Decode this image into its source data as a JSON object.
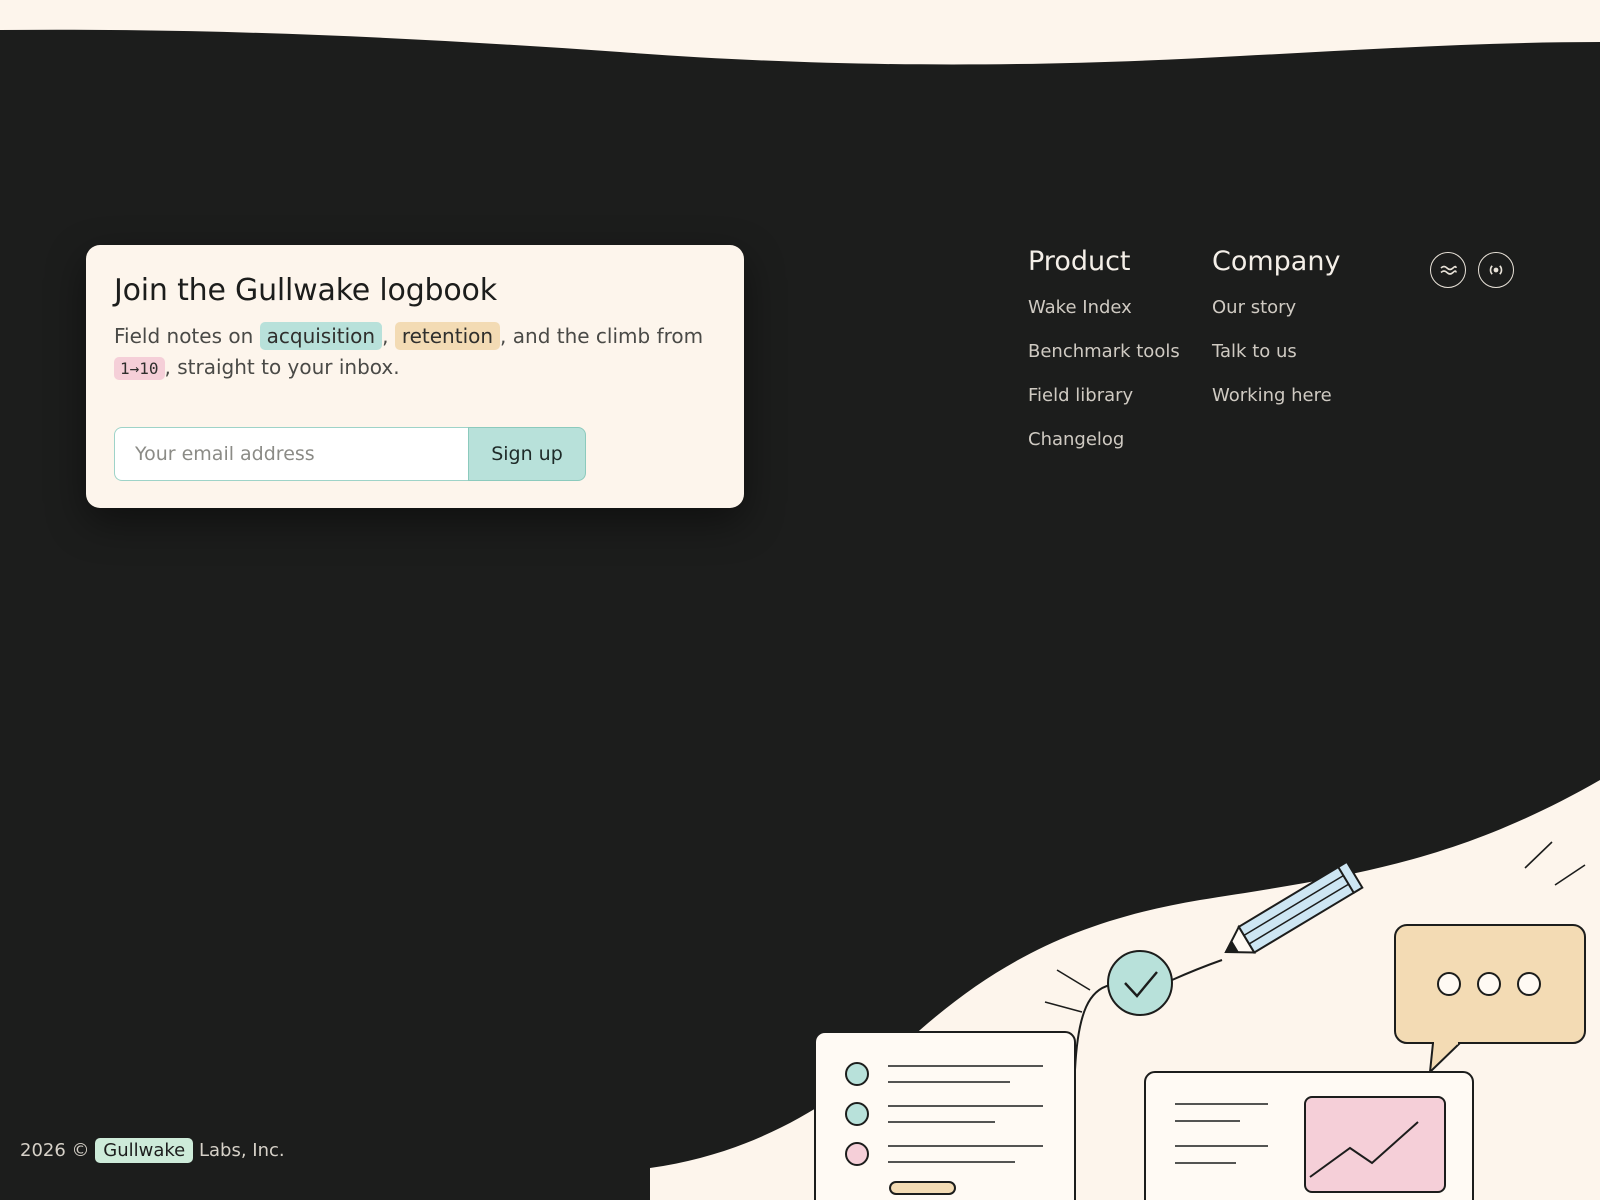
{
  "newsletter": {
    "title": "Join the Gullwake logbook",
    "desc_prefix": "Field notes on ",
    "tag_acquisition": "acquisition",
    "sep_comma": ", ",
    "tag_retention": "retention",
    "desc_mid": ", and the climb from ",
    "tag_range": "1→10",
    "desc_suffix": ", straight to your inbox.",
    "email_placeholder": "Your email address",
    "signup_label": "Sign up"
  },
  "nav": {
    "product": {
      "heading": "Product",
      "links": [
        "Wake Index",
        "Benchmark tools",
        "Field library",
        "Changelog"
      ]
    },
    "company": {
      "heading": "Company",
      "links": [
        "Our story",
        "Talk to us",
        "Working here"
      ]
    }
  },
  "social": [
    "waves-icon",
    "broadcast-icon"
  ],
  "footer": {
    "year_prefix": "2026 ©",
    "brand": "Gullwake",
    "suffix": "Labs, Inc."
  },
  "colors": {
    "background": "#1c1d1c",
    "cream": "#fdf5ec",
    "teal": "#b8e1da",
    "sand": "#f3dbb4",
    "pink": "#f5cfd8"
  }
}
